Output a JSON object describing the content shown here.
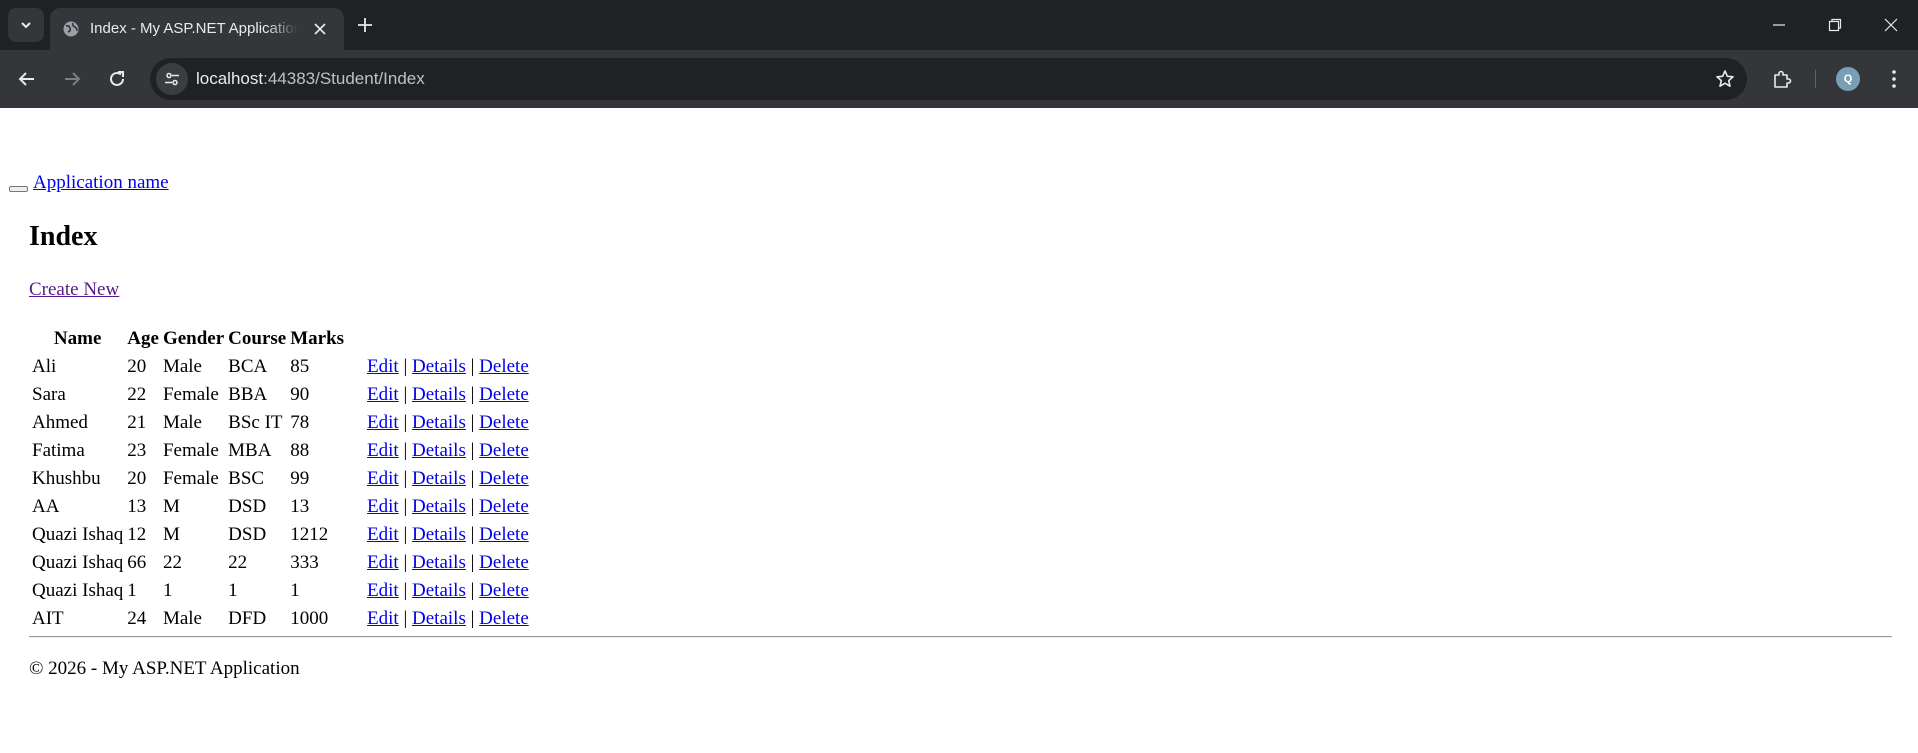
{
  "browser": {
    "tab_title": "Index - My ASP.NET Application",
    "url_host": "localhost",
    "url_rest": ":44383/Student/Index",
    "profile_initial": "Q",
    "icons": {
      "tab_search": "chevron-down-icon",
      "favicon": "globe-icon",
      "tab_close": "close-icon",
      "new_tab": "plus-icon",
      "back": "arrow-left-icon",
      "forward": "arrow-right-icon",
      "reload": "reload-icon",
      "site_info": "tune-icon",
      "bookmark": "star-icon",
      "extensions": "puzzle-icon",
      "menu": "more-vertical-icon",
      "minimize": "minimize-icon",
      "restore": "restore-icon",
      "close_window": "close-icon"
    },
    "colors": {
      "tabstrip": "#202124",
      "toolbar": "#35363a",
      "omnibox": "#202124",
      "avatar": "#7a9fb4"
    }
  },
  "page": {
    "brand": "Application name",
    "heading": "Index",
    "create_new": "Create New",
    "columns": {
      "name": "Name",
      "age": "Age",
      "gender": "Gender",
      "course": "Course",
      "marks": "Marks"
    },
    "action_labels": {
      "edit": "Edit",
      "details": "Details",
      "delete": "Delete",
      "separator": "|"
    },
    "rows": [
      {
        "name": "Ali",
        "age": "20",
        "gender": "Male",
        "course": "BCA",
        "marks": "85"
      },
      {
        "name": "Sara",
        "age": "22",
        "gender": "Female",
        "course": "BBA",
        "marks": "90"
      },
      {
        "name": "Ahmed",
        "age": "21",
        "gender": "Male",
        "course": "BSc IT",
        "marks": "78"
      },
      {
        "name": "Fatima",
        "age": "23",
        "gender": "Female",
        "course": "MBA",
        "marks": "88"
      },
      {
        "name": "Khushbu",
        "age": "20",
        "gender": "Female",
        "course": "BSC",
        "marks": "99"
      },
      {
        "name": "AA",
        "age": "13",
        "gender": "M",
        "course": "DSD",
        "marks": "13"
      },
      {
        "name": "Quazi Ishaq",
        "age": "12",
        "gender": "M",
        "course": "DSD",
        "marks": "1212"
      },
      {
        "name": "Quazi Ishaq",
        "age": "66",
        "gender": "22",
        "course": "22",
        "marks": "333"
      },
      {
        "name": "Quazi Ishaq",
        "age": "1",
        "gender": "1",
        "course": "1",
        "marks": "1"
      },
      {
        "name": "AIT",
        "age": "24",
        "gender": "Male",
        "course": "DFD",
        "marks": "1000"
      }
    ],
    "footer": "© 2026 - My ASP.NET Application",
    "colors": {
      "link": "#0000ee",
      "visited_link": "#551a8b"
    }
  }
}
